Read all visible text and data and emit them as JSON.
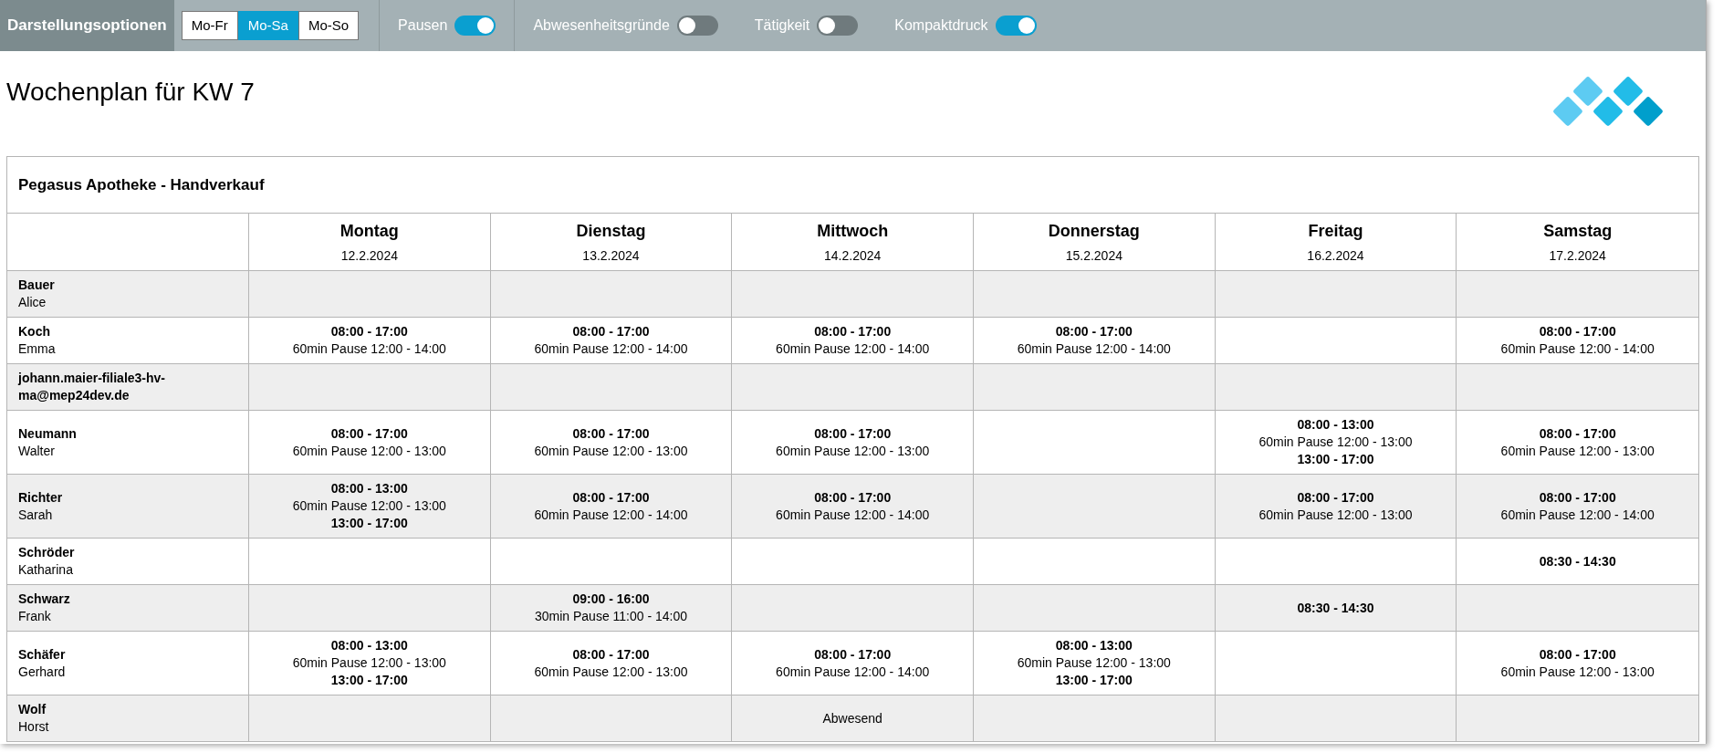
{
  "toolbar": {
    "title": "Darstellungsoptionen",
    "ranges": [
      {
        "label": "Mo-Fr",
        "selected": false
      },
      {
        "label": "Mo-Sa",
        "selected": true
      },
      {
        "label": "Mo-So",
        "selected": false
      }
    ],
    "toggles": [
      {
        "label": "Pausen",
        "on": true
      },
      {
        "label": "Abwesenheitsgründe",
        "on": false
      },
      {
        "label": "Tätigkeit",
        "on": false
      },
      {
        "label": "Kompaktdruck",
        "on": true
      }
    ]
  },
  "heading": "Wochenplan für KW 7",
  "table": {
    "title": "Pegasus Apotheke - Handverkauf",
    "columns": [
      {
        "day": "Montag",
        "date": "12.2.2024"
      },
      {
        "day": "Dienstag",
        "date": "13.2.2024"
      },
      {
        "day": "Mittwoch",
        "date": "14.2.2024"
      },
      {
        "day": "Donnerstag",
        "date": "15.2.2024"
      },
      {
        "day": "Freitag",
        "date": "16.2.2024"
      },
      {
        "day": "Samstag",
        "date": "17.2.2024"
      }
    ],
    "rows": [
      {
        "last_name": "Bauer",
        "first_name": "Alice",
        "cells": [
          [],
          [],
          [],
          [],
          [],
          []
        ]
      },
      {
        "last_name": "Koch",
        "first_name": "Emma",
        "cells": [
          [
            {
              "kind": "shift",
              "text": "08:00 - 17:00"
            },
            {
              "kind": "pause",
              "text": "60min Pause 12:00 - 14:00"
            }
          ],
          [
            {
              "kind": "shift",
              "text": "08:00 - 17:00"
            },
            {
              "kind": "pause",
              "text": "60min Pause 12:00 - 14:00"
            }
          ],
          [
            {
              "kind": "shift",
              "text": "08:00 - 17:00"
            },
            {
              "kind": "pause",
              "text": "60min Pause 12:00 - 14:00"
            }
          ],
          [
            {
              "kind": "shift",
              "text": "08:00 - 17:00"
            },
            {
              "kind": "pause",
              "text": "60min Pause 12:00 - 14:00"
            }
          ],
          [],
          [
            {
              "kind": "shift",
              "text": "08:00 - 17:00"
            },
            {
              "kind": "pause",
              "text": "60min Pause 12:00 - 14:00"
            }
          ]
        ]
      },
      {
        "last_name": "johann.maier-filiale3-hv-ma@mep24dev.de",
        "cells": [
          [],
          [],
          [],
          [],
          [],
          []
        ]
      },
      {
        "last_name": "Neumann",
        "first_name": "Walter",
        "cells": [
          [
            {
              "kind": "shift",
              "text": "08:00 - 17:00"
            },
            {
              "kind": "pause",
              "text": "60min Pause 12:00 - 13:00"
            }
          ],
          [
            {
              "kind": "shift",
              "text": "08:00 - 17:00"
            },
            {
              "kind": "pause",
              "text": "60min Pause 12:00 - 13:00"
            }
          ],
          [
            {
              "kind": "shift",
              "text": "08:00 - 17:00"
            },
            {
              "kind": "pause",
              "text": "60min Pause 12:00 - 13:00"
            }
          ],
          [],
          [
            {
              "kind": "shift",
              "text": "08:00 - 13:00"
            },
            {
              "kind": "pause",
              "text": "60min Pause 12:00 - 13:00"
            },
            {
              "kind": "shift",
              "text": "13:00 - 17:00"
            }
          ],
          [
            {
              "kind": "shift",
              "text": "08:00 - 17:00"
            },
            {
              "kind": "pause",
              "text": "60min Pause 12:00 - 13:00"
            }
          ]
        ]
      },
      {
        "last_name": "Richter",
        "first_name": "Sarah",
        "cells": [
          [
            {
              "kind": "shift",
              "text": "08:00 - 13:00"
            },
            {
              "kind": "pause",
              "text": "60min Pause 12:00 - 13:00"
            },
            {
              "kind": "shift",
              "text": "13:00 - 17:00"
            }
          ],
          [
            {
              "kind": "shift",
              "text": "08:00 - 17:00"
            },
            {
              "kind": "pause",
              "text": "60min Pause 12:00 - 14:00"
            }
          ],
          [
            {
              "kind": "shift",
              "text": "08:00 - 17:00"
            },
            {
              "kind": "pause",
              "text": "60min Pause 12:00 - 14:00"
            }
          ],
          [],
          [
            {
              "kind": "shift",
              "text": "08:00 - 17:00"
            },
            {
              "kind": "pause",
              "text": "60min Pause 12:00 - 13:00"
            }
          ],
          [
            {
              "kind": "shift",
              "text": "08:00 - 17:00"
            },
            {
              "kind": "pause",
              "text": "60min Pause 12:00 - 14:00"
            }
          ]
        ]
      },
      {
        "last_name": "Schröder",
        "first_name": "Katharina",
        "cells": [
          [],
          [],
          [],
          [],
          [],
          [
            {
              "kind": "shift",
              "text": "08:30 - 14:30"
            }
          ]
        ]
      },
      {
        "last_name": "Schwarz",
        "first_name": "Frank",
        "cells": [
          [],
          [
            {
              "kind": "shift",
              "text": "09:00 - 16:00"
            },
            {
              "kind": "pause",
              "text": "30min Pause 11:00 - 14:00"
            }
          ],
          [],
          [],
          [
            {
              "kind": "shift",
              "text": "08:30 - 14:30"
            }
          ],
          []
        ]
      },
      {
        "last_name": "Schäfer",
        "first_name": "Gerhard",
        "cells": [
          [
            {
              "kind": "shift",
              "text": "08:00 - 13:00"
            },
            {
              "kind": "pause",
              "text": "60min Pause 12:00 - 13:00"
            },
            {
              "kind": "shift",
              "text": "13:00 - 17:00"
            }
          ],
          [
            {
              "kind": "shift",
              "text": "08:00 - 17:00"
            },
            {
              "kind": "pause",
              "text": "60min Pause 12:00 - 13:00"
            }
          ],
          [
            {
              "kind": "shift",
              "text": "08:00 - 17:00"
            },
            {
              "kind": "pause",
              "text": "60min Pause 12:00 - 14:00"
            }
          ],
          [
            {
              "kind": "shift",
              "text": "08:00 - 13:00"
            },
            {
              "kind": "pause",
              "text": "60min Pause 12:00 - 13:00"
            },
            {
              "kind": "shift",
              "text": "13:00 - 17:00"
            }
          ],
          [],
          [
            {
              "kind": "shift",
              "text": "08:00 - 17:00"
            },
            {
              "kind": "pause",
              "text": "60min Pause 12:00 - 13:00"
            }
          ]
        ]
      },
      {
        "last_name": "Wolf",
        "first_name": "Horst",
        "cells": [
          [],
          [],
          [
            {
              "kind": "absent",
              "text": "Abwesend"
            }
          ],
          [],
          [],
          []
        ]
      }
    ]
  }
}
